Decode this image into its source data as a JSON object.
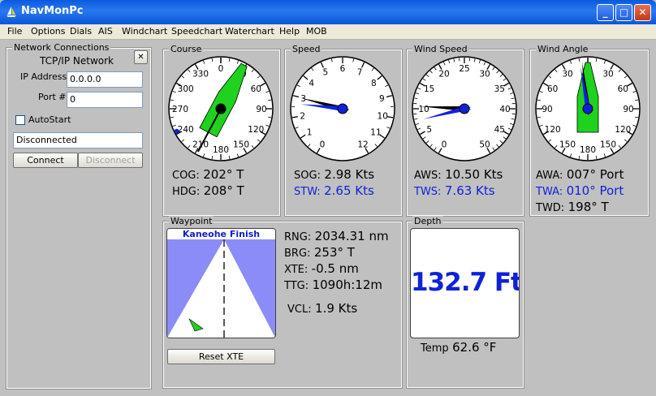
{
  "window": {
    "title": "NavMonPc",
    "minimize": "_",
    "maximize": "□",
    "close": "✕"
  },
  "menu": [
    "File",
    "Options",
    "Dials",
    "AIS",
    "Windchart",
    "Speedchart",
    "Waterchart",
    "Help",
    "MOB"
  ],
  "network": {
    "title": "Network Connections",
    "heading": "TCP/IP Network",
    "close": "✕",
    "ip_label": "IP Address",
    "ip_value": "0.0.0.0",
    "port_label": "Port #",
    "port_value": "0",
    "autostart_label": "AutoStart",
    "autostart_checked": false,
    "status": "Disconnected",
    "connect_label": "Connect",
    "disconnect_label": "Disconnect"
  },
  "course": {
    "title": "Course",
    "ticks": [
      "0",
      "30",
      "60",
      "90",
      "120",
      "150",
      "180",
      "210",
      "240",
      "270",
      "300",
      "330"
    ],
    "cog_label": "COG:",
    "cog_value": "202° T",
    "hdg_label": "HDG:",
    "hdg_value": "208° T",
    "needle_deg": 208
  },
  "speed": {
    "title": "Speed",
    "ticks": [
      "0",
      "1",
      "2",
      "3",
      "4",
      "5",
      "6",
      "7",
      "8",
      "9",
      "10",
      "11",
      "12"
    ],
    "sog_label": "SOG:",
    "sog_value": "2.98 Kts",
    "stw_label": "STW:",
    "stw_value": "2.65 Kts",
    "sog": 2.98,
    "stw": 2.65
  },
  "wind_speed": {
    "title": "Wind Speed",
    "ticks": [
      "0",
      "5",
      "10",
      "15",
      "20",
      "25",
      "30",
      "35",
      "40",
      "45",
      "50"
    ],
    "aws_label": "AWS:",
    "aws_value": "10.50 Kts",
    "tws_label": "TWS:",
    "tws_value": "7.63 Kts",
    "aws": 10.5,
    "tws": 7.63
  },
  "wind_angle": {
    "title": "Wind Angle",
    "ticks": [
      "0",
      "30",
      "60",
      "90",
      "120",
      "150",
      "180",
      "150",
      "120",
      "90",
      "60",
      "30"
    ],
    "awa_label": "AWA:",
    "awa_value": "007° Port",
    "twa_label": "TWA:",
    "twa_value": "010° Port",
    "twd_label": "TWD:",
    "twd_value": "198° T",
    "awa": 7,
    "twa": 10
  },
  "waypoint": {
    "title": "Waypoint",
    "name": "Kaneohe Finish",
    "rng_label": "RNG:",
    "rng_value": "2034.31 nm",
    "brg_label": "BRG:",
    "brg_value": "253° T",
    "xte_label": "XTE:",
    "xte_value": "-0.5 nm",
    "ttg_label": "TTG:",
    "ttg_value": "1090h:12m",
    "vcl_label": "VCL:",
    "vcl_value": "1.9 Kts",
    "reset_label": "Reset XTE"
  },
  "depth": {
    "title": "Depth",
    "value": "132.7 Ft",
    "temp_label": "Temp",
    "temp_value": "62.6 °F"
  },
  "colors": {
    "accent_blue": "#0f22d8",
    "needle_green": "#1ed21e",
    "xte_background": "#8c8cf8"
  }
}
